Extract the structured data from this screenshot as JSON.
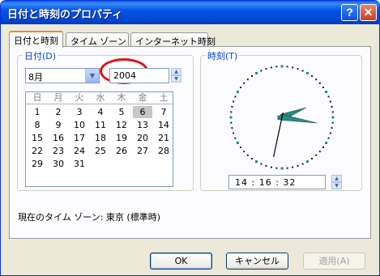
{
  "window": {
    "title": "日付と時刻のプロパティ",
    "help_symbol": "?",
    "close_symbol": "✕"
  },
  "tabs": [
    {
      "label": "日付と時刻",
      "active": true
    },
    {
      "label": "タイム ゾーン",
      "active": false
    },
    {
      "label": "インターネット時刻",
      "active": false
    }
  ],
  "date_group": {
    "label": "日付(D)",
    "month": "8月",
    "year": "2004",
    "weekdays": [
      "日",
      "月",
      "火",
      "水",
      "木",
      "金",
      "土"
    ],
    "weeks": [
      [
        "",
        "",
        "",
        "",
        "",
        "",
        ""
      ],
      [
        "1",
        "2",
        "3",
        "4",
        "5",
        "6",
        "7"
      ],
      [
        "8",
        "9",
        "10",
        "11",
        "12",
        "13",
        "14"
      ],
      [
        "15",
        "16",
        "17",
        "18",
        "19",
        "20",
        "21"
      ],
      [
        "22",
        "23",
        "24",
        "25",
        "26",
        "27",
        "28"
      ],
      [
        "29",
        "30",
        "31",
        "",
        "",
        "",
        ""
      ]
    ],
    "selected_day": "6"
  },
  "time_group": {
    "label": "時刻(T)",
    "time_text": "14 :  16 :  32",
    "hour": 14,
    "minute": 16,
    "second": 32,
    "hand_color": "#2a8a7e"
  },
  "timezone_text": "現在のタイム ゾーン: 東京 (標準時)",
  "buttons": {
    "ok": "OK",
    "cancel": "キャンセル",
    "apply": "適用(A)"
  },
  "icons": {
    "spin_up": "▲",
    "spin_down": "▼",
    "dropdown": "▼"
  },
  "colors": {
    "titlebar": "#0553e6",
    "group_label": "#0046d5",
    "highlight_oval": "#e0101b"
  }
}
